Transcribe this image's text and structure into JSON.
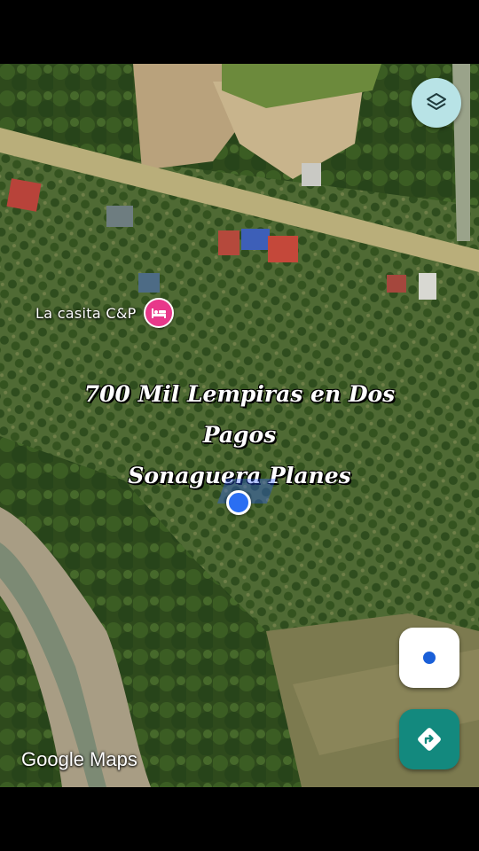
{
  "map": {
    "place_label": "La casita C&P",
    "place_icon": "hotel-bed-icon",
    "place_color": "#e8388a"
  },
  "overlay": {
    "line1": "700 Mil Lempiras en Dos",
    "line2": "Pagos",
    "line3": "Sonaguera Planes"
  },
  "controls": {
    "layers_icon": "layers-icon",
    "my_location_icon": "my-location-icon",
    "directions_icon": "directions-icon",
    "accent": "#13897e"
  },
  "branding": {
    "logo_text": "Google Maps"
  }
}
